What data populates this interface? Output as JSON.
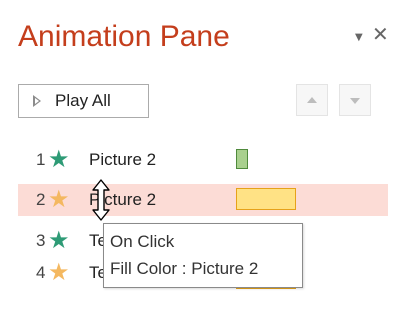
{
  "pane": {
    "title": "Animation Pane",
    "menu_icon": "dropdown-triangle-icon",
    "close_icon": "close-icon",
    "title_color": "#C43E1C"
  },
  "toolbar": {
    "play_all_label": "Play All",
    "play_icon": "play-triangle-icon",
    "move_up_icon": "move-earlier-icon",
    "move_down_icon": "move-later-icon"
  },
  "animations": [
    {
      "number": "1",
      "name": "Picture 2",
      "effect": "entrance",
      "icon": "star-icon",
      "icon_color": "#2E9B76",
      "bar_color": "#A9D08E",
      "bar_border": "#4F8A3C",
      "selected": false
    },
    {
      "number": "2",
      "name": "Picture 2",
      "effect": "emphasis",
      "icon": "star-icon",
      "icon_color": "#F4B860",
      "bar_color": "#FFE285",
      "bar_border": "#E6A21A",
      "selected": true
    },
    {
      "number": "3",
      "name": "Te",
      "effect": "entrance",
      "icon": "star-icon",
      "icon_color": "#2E9B76",
      "selected": false
    },
    {
      "number": "4",
      "name": "Te",
      "effect": "emphasis",
      "icon": "star-icon",
      "icon_color": "#F4B860",
      "selected": false
    }
  ],
  "tooltip": {
    "line1": "On Click",
    "line2": "Fill Color : Picture 2"
  },
  "colors": {
    "selected_row": "#FCDCD6"
  }
}
